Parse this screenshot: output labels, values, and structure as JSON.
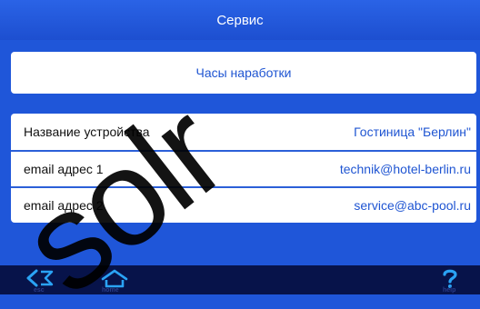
{
  "header": {
    "title": "Сервис"
  },
  "hours_button": {
    "label": "Часы наработки"
  },
  "settings": [
    {
      "label": "Название устройства",
      "value": "Гостиница \"Берлин\""
    },
    {
      "label": "email адрес 1",
      "value": "technik@hotel-berlin.ru"
    },
    {
      "label": "email адрес 2",
      "value": "service@abc-pool.ru"
    }
  ],
  "navbar": {
    "esc": {
      "icon": "back-arrow-icon",
      "caption": "esc"
    },
    "home": {
      "icon": "home-icon",
      "caption": "home"
    },
    "help": {
      "icon": "question-mark-icon",
      "caption": "help"
    }
  },
  "colors": {
    "background": "#1f56d9",
    "accent_text": "#1f55d2",
    "bottom_bar": "#07134a",
    "icon": "#2aa3f5"
  }
}
